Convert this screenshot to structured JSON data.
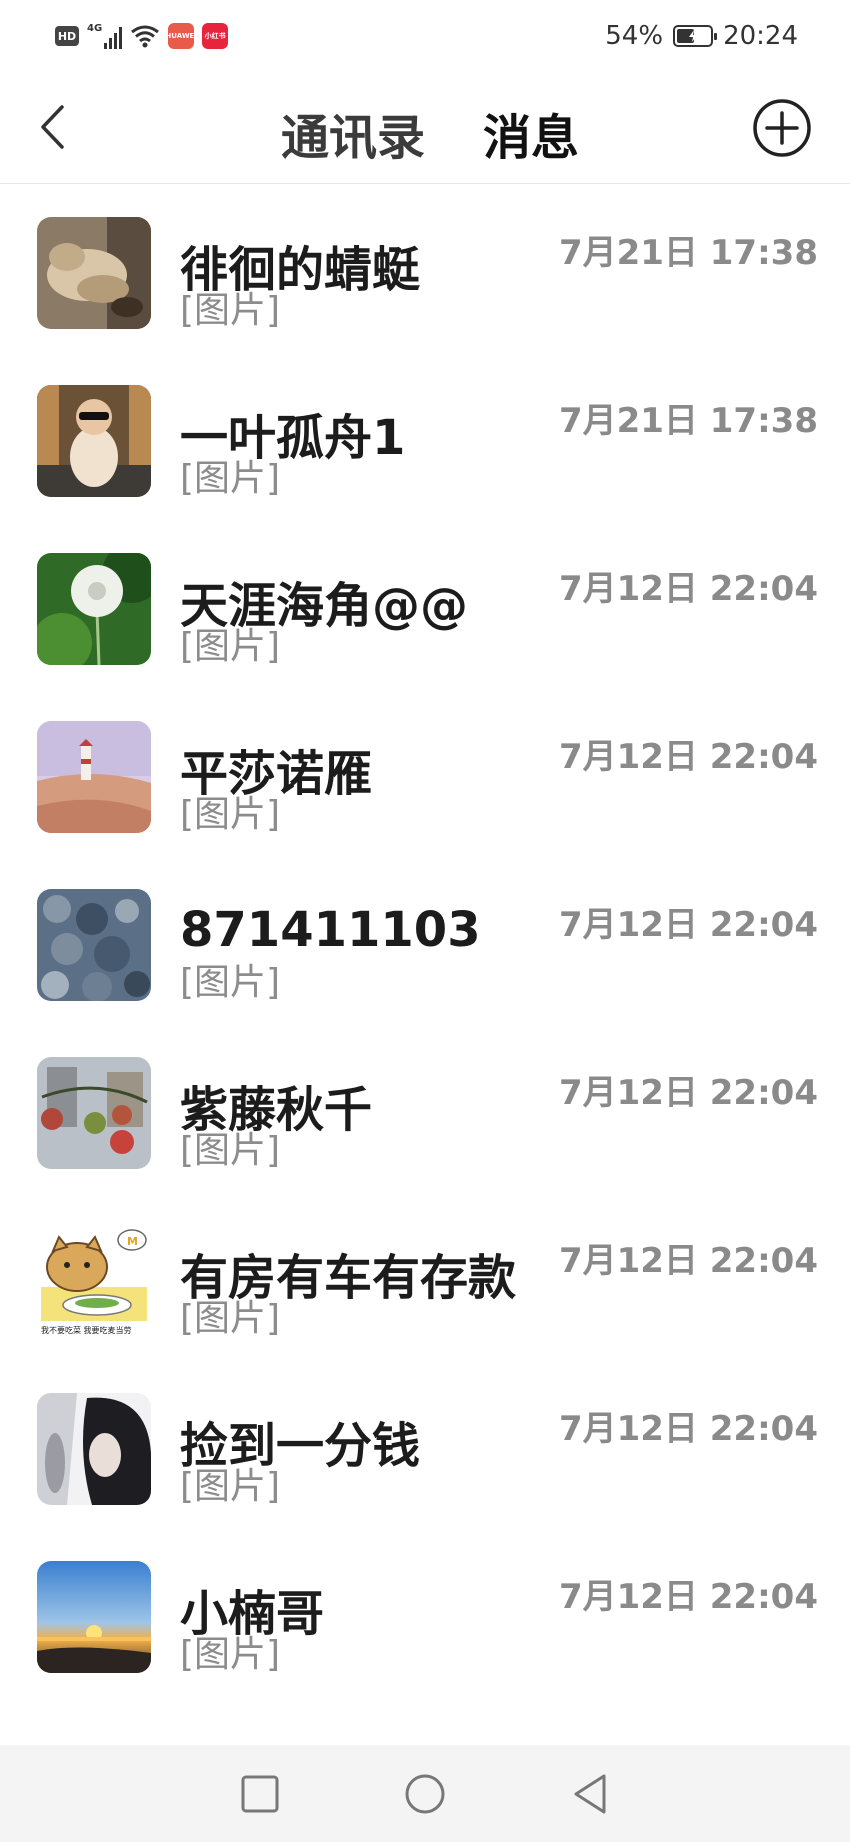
{
  "status_bar": {
    "hd": "HD",
    "network": "4G",
    "app_badge_1": "HUAWEI",
    "app_badge_1_color": "#e85b4a",
    "app_badge_2": "小红书",
    "app_badge_2_color": "#e8243c",
    "battery": "54%",
    "battery_level": 0.54,
    "time": "20:24"
  },
  "header": {
    "tab_contacts": "通讯录",
    "tab_messages": "消息",
    "back_icon": "chevron-left-icon",
    "add_icon": "plus-circle-icon"
  },
  "conversations": [
    {
      "name": "徘徊的蜻蜓",
      "preview": "[图片]",
      "time": "7月21日 17:38",
      "avatar": "cat-photo"
    },
    {
      "name": "一叶孤舟1",
      "preview": "[图片]",
      "time": "7月21日 17:38",
      "avatar": "baby-sunglasses-photo"
    },
    {
      "name": "天涯海角@@",
      "preview": "[图片]",
      "time": "7月12日 22:04",
      "avatar": "dandelion-photo"
    },
    {
      "name": "平莎诺雁",
      "preview": "[图片]",
      "time": "7月12日 22:04",
      "avatar": "lighthouse-dunes-photo"
    },
    {
      "name": "871411103",
      "preview": "[图片]",
      "time": "7月12日 22:04",
      "avatar": "rocks-photo"
    },
    {
      "name": "紫藤秋千",
      "preview": "[图片]",
      "time": "7月12日 22:04",
      "avatar": "tomatoes-photo"
    },
    {
      "name": "有房有车有存款",
      "preview": "[图片]",
      "time": "7月12日 22:04",
      "avatar": "cartoon-cat-sticker",
      "avatar_caption": "我不要吃菜 我要吃麦当劳"
    },
    {
      "name": "捡到一分钱",
      "preview": "[图片]",
      "time": "7月12日 22:04",
      "avatar": "portrait-photo"
    },
    {
      "name": "小楠哥",
      "preview": "[图片]",
      "time": "7月12日 22:04",
      "avatar": "sunset-sea-photo"
    }
  ],
  "system_nav": {
    "recent": "square-icon",
    "home": "circle-icon",
    "back": "triangle-back-icon"
  }
}
